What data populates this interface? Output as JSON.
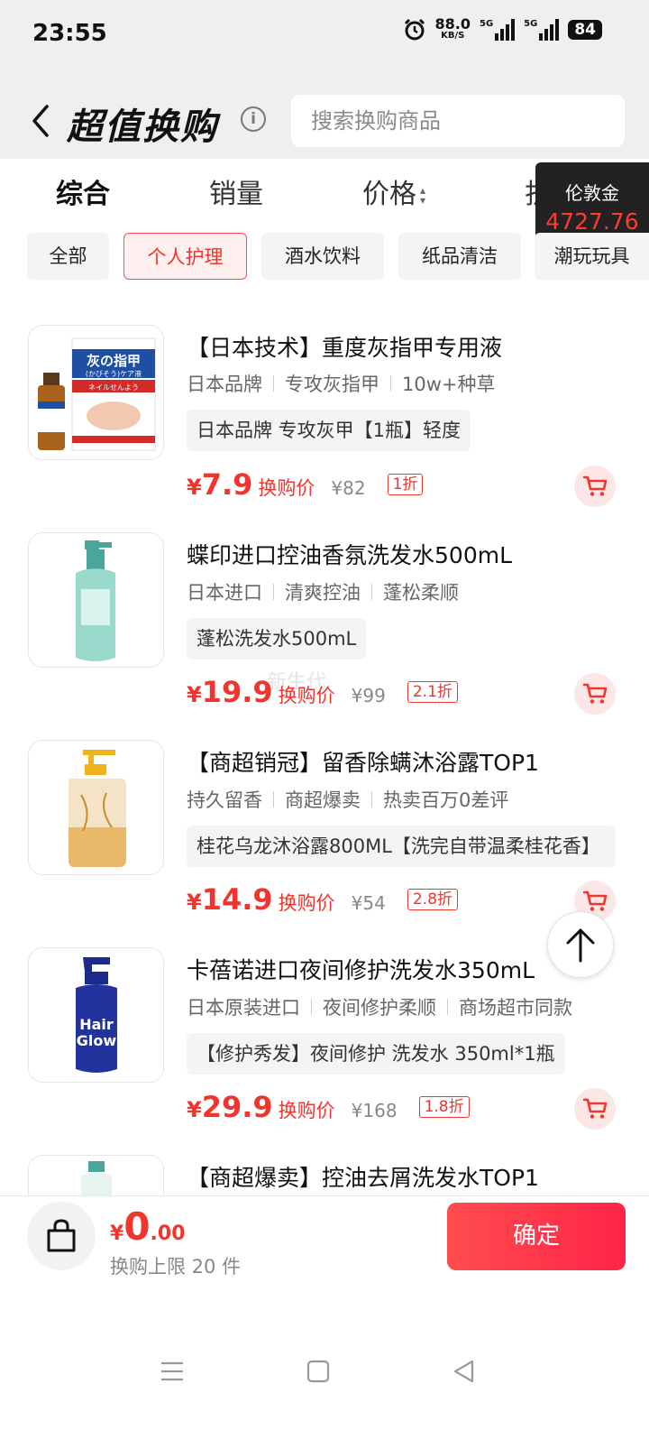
{
  "status_bar": {
    "time": "23:55",
    "speed_value": "88.0",
    "speed_unit": "KB/S",
    "net1": "5G",
    "net2": "5G",
    "battery": "84"
  },
  "header": {
    "title": "超值换购",
    "info_glyph": "i",
    "search_placeholder": "搜索换购商品"
  },
  "sort_tabs": [
    {
      "label": "综合",
      "active": true
    },
    {
      "label": "销量"
    },
    {
      "label": "价格"
    },
    {
      "label": "折"
    }
  ],
  "coin": {
    "label": "伦敦金",
    "value": "4727.76"
  },
  "categories": [
    {
      "label": "全部"
    },
    {
      "label": "个人护理",
      "active": true
    },
    {
      "label": "酒水饮料"
    },
    {
      "label": "纸品清洁"
    },
    {
      "label": "潮玩玩具"
    }
  ],
  "products": [
    {
      "name": "【日本技术】重度灰指甲专用液",
      "tags": [
        "日本品牌",
        "专攻灰指甲",
        "10w+种草"
      ],
      "spec": "日本品牌 专攻灰甲【1瓶】轻度",
      "price_currency": "¥",
      "price": "7.9",
      "price_label": "换购价",
      "original_price": "¥82",
      "discount": "1折",
      "image_text_1": "灰の指甲",
      "image_text_2": "(かびそう)ケア液",
      "image_text_3": "ネイルせんよう"
    },
    {
      "name": "蝶印进口控油香氛洗发水500mL",
      "tags": [
        "日本进口",
        "清爽控油",
        "蓬松柔顺"
      ],
      "spec": "蓬松洗发水500mL",
      "price_currency": "¥",
      "price": "19.9",
      "price_label": "换购价",
      "original_price": "¥99",
      "discount": "2.1折"
    },
    {
      "name": "【商超销冠】留香除螨沐浴露TOP1",
      "tags": [
        "持久留香",
        "商超爆卖",
        "热卖百万0差评"
      ],
      "spec": "桂花乌龙沐浴露800ML【洗完自带温柔桂花香】",
      "price_currency": "¥",
      "price": "14.9",
      "price_label": "换购价",
      "original_price": "¥54",
      "discount": "2.8折"
    },
    {
      "name": "卡蓓诺进口夜间修护洗发水350mL",
      "tags": [
        "日本原装进口",
        "夜间修护柔顺",
        "商场超市同款"
      ],
      "spec": "【修护秀发】夜间修护 洗发水 350ml*1瓶",
      "price_currency": "¥",
      "price": "29.9",
      "price_label": "换购价",
      "original_price": "¥168",
      "discount": "1.8折",
      "image_text_1": "Hair",
      "image_text_2": "Glow"
    },
    {
      "name": "【商超爆卖】控油去屑洗发水TOP1"
    }
  ],
  "watermark": "新生代",
  "bottom_bar": {
    "currency": "¥",
    "total_int": "0",
    "total_dec": ".00",
    "limit_text": "换购上限 20 件",
    "confirm_label": "确定"
  },
  "icons": [
    "back-chevron-icon",
    "info-icon",
    "sort-arrows-icon",
    "cart-icon",
    "arrow-up-icon",
    "shopping-bag-icon",
    "menu-icon",
    "home-square-icon",
    "back-triangle-icon"
  ],
  "colors": {
    "accent": "#f0352e",
    "confirm_button": "#ff2448",
    "coin_bg": "#222222"
  }
}
